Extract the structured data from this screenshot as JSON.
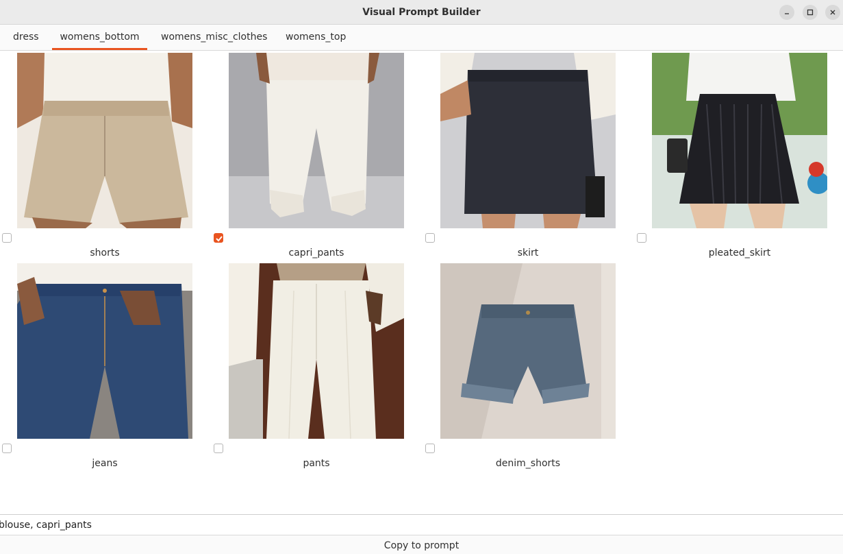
{
  "window": {
    "title": "Visual Prompt Builder"
  },
  "tabs": [
    {
      "label": "dress",
      "active": false
    },
    {
      "label": "womens_bottom",
      "active": true
    },
    {
      "label": "womens_misc_clothes",
      "active": false
    },
    {
      "label": "womens_top",
      "active": false
    }
  ],
  "items": [
    {
      "label": "shorts",
      "checked": false
    },
    {
      "label": "capri_pants",
      "checked": true
    },
    {
      "label": "skirt",
      "checked": false
    },
    {
      "label": "pleated_skirt",
      "checked": false
    },
    {
      "label": "jeans",
      "checked": false
    },
    {
      "label": "pants",
      "checked": false
    },
    {
      "label": "denim_shorts",
      "checked": false
    }
  ],
  "prompt": {
    "value": "blouse, capri_pants"
  },
  "copy_button": {
    "label": "Copy to prompt"
  },
  "colors": {
    "accent": "#e95420",
    "titlebar": "#ebebeb"
  }
}
